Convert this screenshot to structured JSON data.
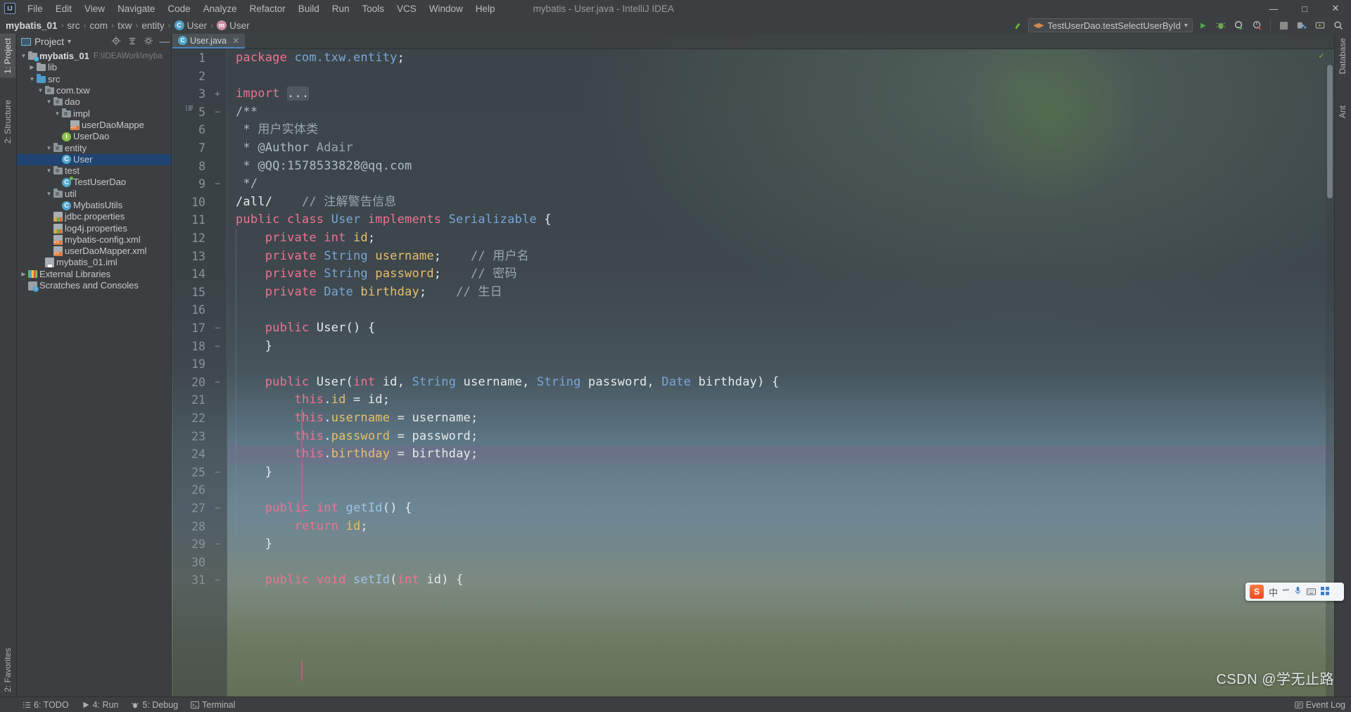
{
  "window": {
    "title": "mybatis - User.java - IntelliJ IDEA",
    "logo": "IJ",
    "minimize": "—",
    "maximize": "□",
    "close": "✕"
  },
  "menu": {
    "items": [
      "File",
      "Edit",
      "View",
      "Navigate",
      "Code",
      "Analyze",
      "Refactor",
      "Build",
      "Run",
      "Tools",
      "VCS",
      "Window",
      "Help"
    ]
  },
  "breadcrumb": {
    "items": [
      {
        "label": "mybatis_01",
        "icon": "",
        "bold": true
      },
      {
        "label": "src",
        "icon": "",
        "bold": false
      },
      {
        "label": "com",
        "icon": "",
        "bold": false
      },
      {
        "label": "txw",
        "icon": "",
        "bold": false
      },
      {
        "label": "entity",
        "icon": "",
        "bold": false
      },
      {
        "label": "User",
        "icon": "class-icon",
        "bold": false
      },
      {
        "label": "User",
        "icon": "method-icon",
        "bold": false
      }
    ],
    "separator": "›"
  },
  "toolbar": {
    "run_config": "TestUserDao.testSelectUserById",
    "run_config_left_icon": "◀▶",
    "dropdown_arrow": "▾",
    "hammer_icon": "↖",
    "buttons": [
      {
        "name": "run-button",
        "glyph": "▶",
        "color": "#4caf50"
      },
      {
        "name": "debug-button",
        "glyph": "ὁe",
        "color": "#6aa84f"
      },
      {
        "name": "run-with-coverage-button",
        "glyph": "◑",
        "color": "#8ab46a"
      },
      {
        "name": "profile-button",
        "glyph": "◴",
        "color": "#b0b0b0"
      },
      {
        "name": "stop-button",
        "glyph": "■",
        "color": "#8a8a8a"
      },
      {
        "name": "project-structure-button",
        "glyph": "▤",
        "color": "#b0b0b0"
      },
      {
        "name": "updates-button",
        "glyph": "▷",
        "color": "#b0b0b0"
      },
      {
        "name": "search-everywhere-button",
        "glyph": "⌕",
        "color": "#c0c0c0"
      }
    ]
  },
  "left_strip": {
    "project_tab": "1: Project",
    "structure_tab": "2: Structure",
    "favorites_tab": "2: Favorites"
  },
  "right_strip": {
    "database_tab": "Database",
    "ant_tab": "Ant"
  },
  "project_panel": {
    "title": "Project",
    "dropdown": "▾",
    "icons": [
      "locate-icon",
      "collapse-all-icon",
      "settings-icon",
      "hide-icon"
    ],
    "tree": [
      {
        "depth": 0,
        "arrow": "▼",
        "icon": "module-folder",
        "label": "mybatis_01",
        "sub": "F:\\IDEAWork\\myba",
        "bold": true,
        "selected": false
      },
      {
        "depth": 1,
        "arrow": "▶",
        "icon": "folder-gray",
        "label": "lib",
        "sub": "",
        "bold": false,
        "selected": false
      },
      {
        "depth": 1,
        "arrow": "▼",
        "icon": "folder-blue",
        "label": "src",
        "sub": "",
        "bold": false,
        "selected": false
      },
      {
        "depth": 2,
        "arrow": "▼",
        "icon": "package",
        "label": "com.txw",
        "sub": "",
        "bold": false,
        "selected": false
      },
      {
        "depth": 3,
        "arrow": "▼",
        "icon": "package",
        "label": "dao",
        "sub": "",
        "bold": false,
        "selected": false
      },
      {
        "depth": 4,
        "arrow": "▼",
        "icon": "package",
        "label": "impl",
        "sub": "",
        "bold": false,
        "selected": false
      },
      {
        "depth": 5,
        "arrow": "",
        "icon": "xml-file",
        "label": "userDaoMappe",
        "sub": "",
        "bold": false,
        "selected": false
      },
      {
        "depth": 4,
        "arrow": "",
        "icon": "interface",
        "label": "UserDao",
        "sub": "",
        "bold": false,
        "selected": false
      },
      {
        "depth": 3,
        "arrow": "▼",
        "icon": "package",
        "label": "entity",
        "sub": "",
        "bold": false,
        "selected": false
      },
      {
        "depth": 4,
        "arrow": "",
        "icon": "class",
        "label": "User",
        "sub": "",
        "bold": false,
        "selected": true
      },
      {
        "depth": 3,
        "arrow": "▼",
        "icon": "package",
        "label": "test",
        "sub": "",
        "bold": false,
        "selected": false
      },
      {
        "depth": 4,
        "arrow": "",
        "icon": "test-class",
        "label": "TestUserDao",
        "sub": "",
        "bold": false,
        "selected": false
      },
      {
        "depth": 3,
        "arrow": "▼",
        "icon": "package",
        "label": "util",
        "sub": "",
        "bold": false,
        "selected": false
      },
      {
        "depth": 4,
        "arrow": "",
        "icon": "class",
        "label": "MybatisUtils",
        "sub": "",
        "bold": false,
        "selected": false
      },
      {
        "depth": 3,
        "arrow": "",
        "icon": "properties-file",
        "label": "jdbc.properties",
        "sub": "",
        "bold": false,
        "selected": false
      },
      {
        "depth": 3,
        "arrow": "",
        "icon": "properties-file",
        "label": "log4j.properties",
        "sub": "",
        "bold": false,
        "selected": false
      },
      {
        "depth": 3,
        "arrow": "",
        "icon": "xml-file",
        "label": "mybatis-config.xml",
        "sub": "",
        "bold": false,
        "selected": false
      },
      {
        "depth": 3,
        "arrow": "",
        "icon": "xml-file",
        "label": "userDaoMapper.xml",
        "sub": "",
        "bold": false,
        "selected": false
      },
      {
        "depth": 2,
        "arrow": "",
        "icon": "iml-file",
        "label": "mybatis_01.iml",
        "sub": "",
        "bold": false,
        "selected": false
      },
      {
        "depth": 0,
        "arrow": "▶",
        "icon": "libraries",
        "label": "External Libraries",
        "sub": "",
        "bold": false,
        "selected": false
      },
      {
        "depth": 0,
        "arrow": "",
        "icon": "scratches",
        "label": "Scratches and Consoles",
        "sub": "",
        "bold": false,
        "selected": false
      }
    ]
  },
  "editor": {
    "tab": {
      "label": "User.java",
      "icon": "class-icon",
      "close": "✕"
    },
    "lines": [
      {
        "num": "1",
        "fold": "",
        "tokens": [
          {
            "t": "package ",
            "c": "kw2"
          },
          {
            "t": "com.txw.entity",
            "c": "type"
          },
          {
            "t": ";",
            "c": "txt"
          }
        ]
      },
      {
        "num": "2",
        "fold": "",
        "tokens": []
      },
      {
        "num": "3",
        "fold": "+",
        "tokens": [
          {
            "t": "import ",
            "c": "kw2"
          },
          {
            "t": "...",
            "c": "folded"
          }
        ]
      },
      {
        "num": "5",
        "fold": "−",
        "tokens": [
          {
            "t": "/**",
            "c": "cmtd"
          }
        ]
      },
      {
        "num": "6",
        "fold": "",
        "tokens": [
          {
            "t": " * ",
            "c": "cmtd"
          },
          {
            "t": "用户实体类",
            "c": "cmt"
          }
        ]
      },
      {
        "num": "7",
        "fold": "",
        "tokens": [
          {
            "t": " * ",
            "c": "cmtd"
          },
          {
            "t": "@Author",
            "c": "cmtd"
          },
          {
            "t": " Adair",
            "c": "cmt"
          }
        ]
      },
      {
        "num": "8",
        "fold": "",
        "tokens": [
          {
            "t": " * ",
            "c": "cmtd"
          },
          {
            "t": "@QQ:1578533828@qq.com",
            "c": "cmtd"
          }
        ]
      },
      {
        "num": "9",
        "fold": "−",
        "tokens": [
          {
            "t": " */",
            "c": "cmtd"
          }
        ]
      },
      {
        "num": "10",
        "fold": "",
        "tokens": [
          {
            "t": "/all/",
            "c": "txt"
          },
          {
            "t": "    ",
            "c": "txt"
          },
          {
            "t": "// ",
            "c": "cmt"
          },
          {
            "t": "注解警告信息",
            "c": "cmt"
          }
        ]
      },
      {
        "num": "11",
        "fold": "",
        "tokens": [
          {
            "t": "public class ",
            "c": "kw2"
          },
          {
            "t": "User",
            "c": "type"
          },
          {
            "t": " implements ",
            "c": "kw2"
          },
          {
            "t": "Serializable",
            "c": "type"
          },
          {
            "t": " {",
            "c": "txt"
          }
        ]
      },
      {
        "num": "12",
        "fold": "",
        "tokens": [
          {
            "t": "    ",
            "c": "txt"
          },
          {
            "t": "private int ",
            "c": "kw2"
          },
          {
            "t": "id",
            "c": "fieldv"
          },
          {
            "t": ";",
            "c": "txt"
          }
        ]
      },
      {
        "num": "13",
        "fold": "",
        "tokens": [
          {
            "t": "    ",
            "c": "txt"
          },
          {
            "t": "private ",
            "c": "kw2"
          },
          {
            "t": "String",
            "c": "type"
          },
          {
            "t": " ",
            "c": "txt"
          },
          {
            "t": "username",
            "c": "fieldv"
          },
          {
            "t": ";",
            "c": "txt"
          },
          {
            "t": "    ",
            "c": "txt"
          },
          {
            "t": "// ",
            "c": "cmt"
          },
          {
            "t": "用户名",
            "c": "cmt"
          }
        ]
      },
      {
        "num": "14",
        "fold": "",
        "tokens": [
          {
            "t": "    ",
            "c": "txt"
          },
          {
            "t": "private ",
            "c": "kw2"
          },
          {
            "t": "String",
            "c": "type"
          },
          {
            "t": " ",
            "c": "txt"
          },
          {
            "t": "password",
            "c": "fieldv"
          },
          {
            "t": ";",
            "c": "txt"
          },
          {
            "t": "    ",
            "c": "txt"
          },
          {
            "t": "// ",
            "c": "cmt"
          },
          {
            "t": "密码",
            "c": "cmt"
          }
        ]
      },
      {
        "num": "15",
        "fold": "",
        "tokens": [
          {
            "t": "    ",
            "c": "txt"
          },
          {
            "t": "private ",
            "c": "kw2"
          },
          {
            "t": "Date",
            "c": "type"
          },
          {
            "t": " ",
            "c": "txt"
          },
          {
            "t": "birthday",
            "c": "fieldv"
          },
          {
            "t": ";",
            "c": "txt"
          },
          {
            "t": "    ",
            "c": "txt"
          },
          {
            "t": "// ",
            "c": "cmt"
          },
          {
            "t": "生日",
            "c": "cmt"
          }
        ]
      },
      {
        "num": "16",
        "fold": "",
        "tokens": []
      },
      {
        "num": "17",
        "fold": "−",
        "tokens": [
          {
            "t": "    ",
            "c": "txt"
          },
          {
            "t": "public ",
            "c": "kw2"
          },
          {
            "t": "User",
            "c": "txt"
          },
          {
            "t": "() {",
            "c": "txt"
          }
        ]
      },
      {
        "num": "18",
        "fold": "−",
        "tokens": [
          {
            "t": "    }",
            "c": "txt"
          }
        ]
      },
      {
        "num": "19",
        "fold": "",
        "tokens": []
      },
      {
        "num": "20",
        "fold": "−",
        "tokens": [
          {
            "t": "    ",
            "c": "txt"
          },
          {
            "t": "public ",
            "c": "kw2"
          },
          {
            "t": "User",
            "c": "txt"
          },
          {
            "t": "(",
            "c": "txt"
          },
          {
            "t": "int ",
            "c": "kw2"
          },
          {
            "t": "id, ",
            "c": "txt"
          },
          {
            "t": "String",
            "c": "type"
          },
          {
            "t": " username, ",
            "c": "txt"
          },
          {
            "t": "String",
            "c": "type"
          },
          {
            "t": " password, ",
            "c": "txt"
          },
          {
            "t": "Date",
            "c": "type"
          },
          {
            "t": " birthday) {",
            "c": "txt"
          }
        ]
      },
      {
        "num": "21",
        "fold": "",
        "tokens": [
          {
            "t": "        ",
            "c": "txt"
          },
          {
            "t": "this",
            "c": "kw2"
          },
          {
            "t": ".",
            "c": "txt"
          },
          {
            "t": "id",
            "c": "fieldv"
          },
          {
            "t": " = id;",
            "c": "txt"
          }
        ]
      },
      {
        "num": "22",
        "fold": "",
        "tokens": [
          {
            "t": "        ",
            "c": "txt"
          },
          {
            "t": "this",
            "c": "kw2"
          },
          {
            "t": ".",
            "c": "txt"
          },
          {
            "t": "username",
            "c": "fieldv"
          },
          {
            "t": " = username;",
            "c": "txt"
          }
        ]
      },
      {
        "num": "23",
        "fold": "",
        "tokens": [
          {
            "t": "        ",
            "c": "txt"
          },
          {
            "t": "this",
            "c": "kw2"
          },
          {
            "t": ".",
            "c": "txt"
          },
          {
            "t": "password",
            "c": "fieldv"
          },
          {
            "t": " = password;",
            "c": "txt"
          }
        ]
      },
      {
        "num": "24",
        "fold": "",
        "highlight": true,
        "tokens": [
          {
            "t": "        ",
            "c": "txt"
          },
          {
            "t": "this",
            "c": "kw2"
          },
          {
            "t": ".",
            "c": "txt"
          },
          {
            "t": "birthday",
            "c": "fieldv"
          },
          {
            "t": " = birthday;",
            "c": "txt"
          }
        ]
      },
      {
        "num": "25",
        "fold": "−",
        "tokens": [
          {
            "t": "    }",
            "c": "txt"
          }
        ]
      },
      {
        "num": "26",
        "fold": "",
        "tokens": []
      },
      {
        "num": "27",
        "fold": "−",
        "tokens": [
          {
            "t": "    ",
            "c": "txt"
          },
          {
            "t": "public int ",
            "c": "kw2"
          },
          {
            "t": "getId",
            "c": "meth"
          },
          {
            "t": "() {",
            "c": "txt"
          }
        ]
      },
      {
        "num": "28",
        "fold": "",
        "tokens": [
          {
            "t": "        ",
            "c": "txt"
          },
          {
            "t": "return ",
            "c": "kw2"
          },
          {
            "t": "id",
            "c": "fieldv"
          },
          {
            "t": ";",
            "c": "txt"
          }
        ]
      },
      {
        "num": "29",
        "fold": "−",
        "tokens": [
          {
            "t": "    }",
            "c": "txt"
          }
        ]
      },
      {
        "num": "30",
        "fold": "",
        "tokens": []
      },
      {
        "num": "31",
        "fold": "−",
        "tokens": [
          {
            "t": "    ",
            "c": "txt"
          },
          {
            "t": "public void ",
            "c": "kw2"
          },
          {
            "t": "setId",
            "c": "meth"
          },
          {
            "t": "(",
            "c": "txt"
          },
          {
            "t": "int ",
            "c": "kw2"
          },
          {
            "t": "id) {",
            "c": "txt"
          }
        ]
      }
    ],
    "inspection_icon": "✓"
  },
  "status_bar": {
    "left_items": [
      {
        "icon": "todo-icon",
        "label": "6: TODO"
      },
      {
        "icon": "run-icon",
        "label": "4: Run"
      },
      {
        "icon": "debug-icon",
        "label": "5: Debug"
      },
      {
        "icon": "terminal-icon",
        "label": "Terminal"
      }
    ],
    "right_items": [
      {
        "icon": "event-log-icon",
        "label": "Event Log"
      }
    ]
  },
  "ime_bar": {
    "logo": "S",
    "mode": "中",
    "punct": "“”",
    "mic": "Ἲ4",
    "keyboard": "⌨",
    "menu": "☷"
  },
  "watermark": {
    "text": "CSDN @学无止路"
  },
  "colors": {
    "accent_blue": "#4a88c7",
    "selection": "#1f4472",
    "keyword_pink": "#f07294",
    "type_blue": "#7aa6d8",
    "field_gold": "#e8bf6a",
    "comment_gray": "#9aa7ad",
    "chrome": "#3c3f41"
  }
}
